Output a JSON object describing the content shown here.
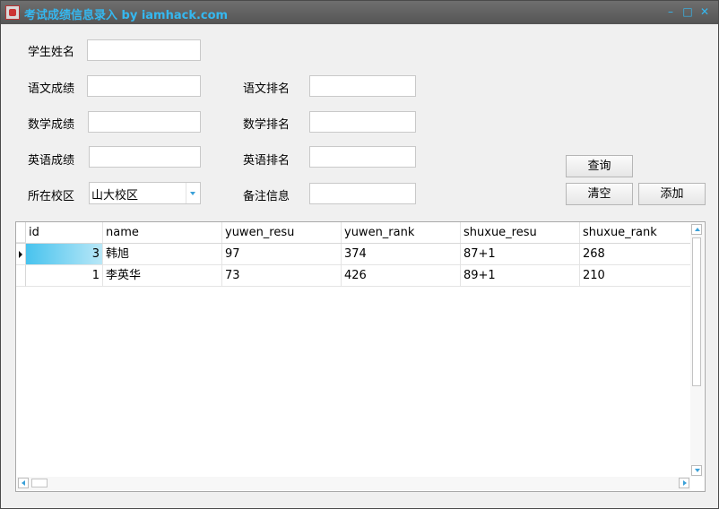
{
  "window": {
    "title": "考试成绩信息录入 by iamhack.com",
    "controls": {
      "minimize": "–",
      "maximize": "□",
      "close": "✕"
    }
  },
  "form": {
    "labels": {
      "name": "学生姓名",
      "yuwen_score": "语文成绩",
      "yuwen_rank": "语文排名",
      "shuxue_score": "数学成绩",
      "shuxue_rank": "数学排名",
      "yingyu_score": "英语成绩",
      "yingyu_rank": "英语排名",
      "campus": "所在校区",
      "remark": "备注信息"
    },
    "values": {
      "name": "",
      "yuwen_score": "",
      "yuwen_rank": "",
      "shuxue_score": "",
      "shuxue_rank": "",
      "yingyu_score": "",
      "yingyu_rank": "",
      "remark": ""
    },
    "campus_selected": "山大校区"
  },
  "buttons": {
    "query": "查询",
    "clear": "清空",
    "add": "添加"
  },
  "grid": {
    "columns": [
      "id",
      "name",
      "yuwen_resu",
      "yuwen_rank",
      "shuxue_resu",
      "shuxue_rank"
    ],
    "rows": [
      [
        "3",
        "韩旭",
        "97",
        "374",
        "87+1",
        "268"
      ],
      [
        "1",
        "李英华",
        "73",
        "426",
        "89+1",
        "210"
      ]
    ]
  },
  "colors": {
    "title_accent": "#35b8f0",
    "selection": "#48c3ee"
  }
}
